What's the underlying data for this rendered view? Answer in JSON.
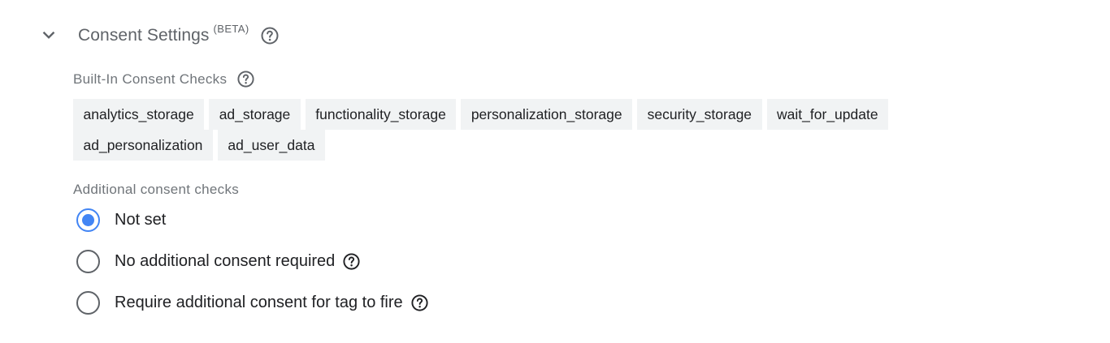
{
  "section": {
    "title": "Consent Settings",
    "badge": "(BETA)",
    "expanded": true
  },
  "builtin": {
    "heading": "Built-In Consent Checks",
    "chips": [
      "analytics_storage",
      "ad_storage",
      "functionality_storage",
      "personalization_storage",
      "security_storage",
      "wait_for_update",
      "ad_personalization",
      "ad_user_data"
    ]
  },
  "additional": {
    "heading": "Additional consent checks",
    "options": [
      {
        "label": "Not set",
        "selected": true,
        "help": false
      },
      {
        "label": "No additional consent required",
        "selected": false,
        "help": true
      },
      {
        "label": "Require additional consent for tag to fire",
        "selected": false,
        "help": true
      }
    ]
  },
  "colors": {
    "accent": "#4285f4",
    "chip_bg": "#f1f3f4",
    "secondary_text": "#5f6368"
  },
  "icons": {
    "chevron": "chevron-down-icon",
    "help": "help-circle-icon"
  }
}
